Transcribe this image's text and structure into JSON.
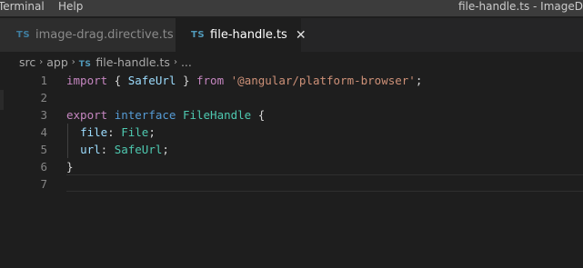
{
  "menu": {
    "terminal": "Terminal",
    "help": "Help"
  },
  "window_title": "file-handle.ts - ImageD",
  "tabs": [
    {
      "label": "image-drag.directive.ts",
      "icon": "TS",
      "active": false
    },
    {
      "label": "file-handle.ts",
      "icon": "TS",
      "active": true,
      "close": "✕"
    }
  ],
  "breadcrumb": {
    "items": [
      "src",
      "app",
      "file-handle.ts",
      "..."
    ],
    "file_icon": "TS",
    "separator": "›"
  },
  "editor": {
    "line_numbers": [
      "1",
      "2",
      "3",
      "4",
      "5",
      "6",
      "7"
    ],
    "lines": [
      [
        {
          "t": "import",
          "c": "kwc"
        },
        {
          "t": " { ",
          "c": "punc"
        },
        {
          "t": "SafeUrl",
          "c": "var"
        },
        {
          "t": " } ",
          "c": "punc"
        },
        {
          "t": "from",
          "c": "kwc"
        },
        {
          "t": " ",
          "c": "punc"
        },
        {
          "t": "'@angular/platform-browser'",
          "c": "str"
        },
        {
          "t": ";",
          "c": "punc"
        }
      ],
      [],
      [
        {
          "t": "export",
          "c": "kwc"
        },
        {
          "t": " ",
          "c": "punc"
        },
        {
          "t": "interface",
          "c": "kw"
        },
        {
          "t": " ",
          "c": "punc"
        },
        {
          "t": "FileHandle",
          "c": "type"
        },
        {
          "t": " {",
          "c": "punc"
        }
      ],
      [
        {
          "t": "  ",
          "c": "punc"
        },
        {
          "t": "file",
          "c": "var"
        },
        {
          "t": ": ",
          "c": "punc"
        },
        {
          "t": "File",
          "c": "type"
        },
        {
          "t": ";",
          "c": "punc"
        }
      ],
      [
        {
          "t": "  ",
          "c": "punc"
        },
        {
          "t": "url",
          "c": "var"
        },
        {
          "t": ": ",
          "c": "punc"
        },
        {
          "t": "SafeUrl",
          "c": "type"
        },
        {
          "t": ";",
          "c": "punc"
        }
      ],
      [
        {
          "t": "}",
          "c": "punc"
        }
      ],
      []
    ]
  }
}
